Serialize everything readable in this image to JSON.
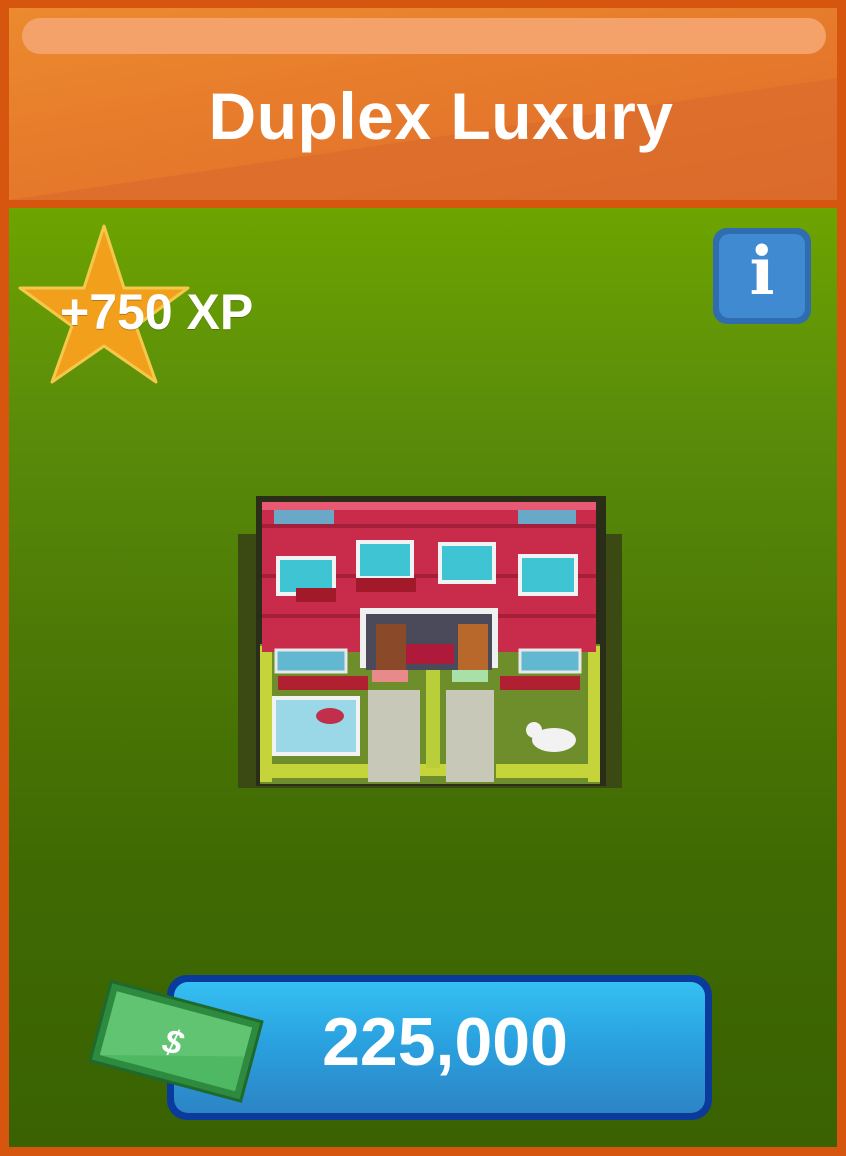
{
  "card": {
    "title": "Duplex Luxury",
    "xp_label": "+750 XP",
    "info_glyph": "i",
    "price": "225,000",
    "currency_glyph": "$"
  },
  "icons": {
    "xp": "star-icon",
    "info": "info-icon",
    "currency": "dollar-bill-icon",
    "item": "duplex-house-image"
  },
  "colors": {
    "frame": "#d6560f",
    "header": "#e5782b",
    "body_top": "#6da400",
    "body_bottom": "#3a6202",
    "star": "#f2a01c",
    "info_button": "#3f8ad0",
    "price_button": "#2aa2e0",
    "bill": "#3aa553"
  }
}
